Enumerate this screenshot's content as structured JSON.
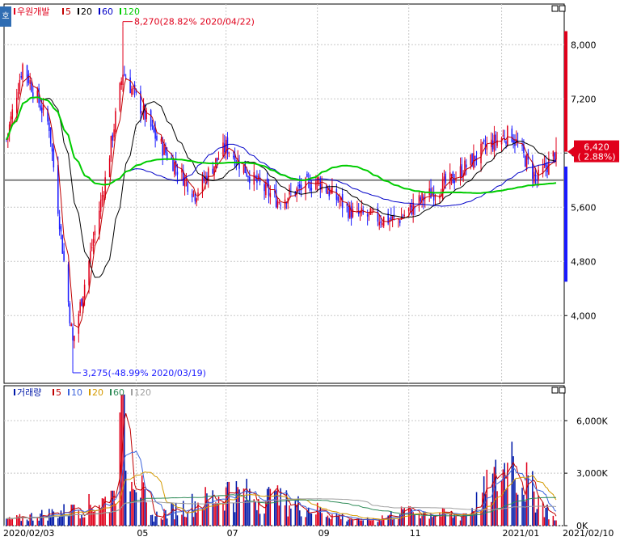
{
  "corner_label": "호",
  "colors": {
    "up": "#e0001b",
    "down": "#1a1aff",
    "ma5": "#c00000",
    "ma20": "#000000",
    "ma60": "#0000c8",
    "ma120": "#00cc00",
    "vol_ma5": "#c00000",
    "vol_ma10": "#3c64dc",
    "vol_ma20": "#d49a00",
    "vol_ma60": "#2e8b57",
    "vol_ma120": "#a0a0a0",
    "volume_bar": "#0018a8",
    "volume_bar_up": "#e0001b",
    "reference_line": "#808080",
    "grid": "#c8c8c8"
  },
  "chart_data": [
    {
      "type": "candlestick",
      "legend": [
        {
          "label": "우원개발",
          "color_key": "up"
        },
        {
          "label": "5",
          "color_key": "ma5"
        },
        {
          "label": "20",
          "color_key": "ma20"
        },
        {
          "label": "60",
          "color_key": "ma60"
        },
        {
          "label": "120",
          "color_key": "ma120"
        }
      ],
      "ylim": [
        3000,
        8600
      ],
      "yticks": [
        8000,
        7200,
        6400,
        5600,
        4800,
        4000
      ],
      "ytick_labels": [
        "8,000",
        "7,200",
        "6,400",
        "5,600",
        "4,800",
        "4,000"
      ],
      "current_price": "6,420",
      "current_change": "( 2.88%)",
      "current_value": 6420,
      "reference_value": 6000,
      "high_annotation": {
        "text": "8,270(28.82% 2020/04/22)",
        "value": 8270,
        "date": "2020/04/22"
      },
      "low_annotation": {
        "text": "3,275(-48.99% 2020/03/19)",
        "value": 3275,
        "date": "2020/03/19"
      },
      "key_points": [
        {
          "date": "2020/02/03",
          "close": 6600
        },
        {
          "date": "2020/02/14",
          "close": 7700
        },
        {
          "date": "2020/03/03",
          "close": 6800
        },
        {
          "date": "2020/03/19",
          "close": 3600
        },
        {
          "date": "2020/04/10",
          "close": 6000
        },
        {
          "date": "2020/04/22",
          "close": 7600
        },
        {
          "date": "2020/05/15",
          "close": 6600
        },
        {
          "date": "2020/06/10",
          "close": 5800
        },
        {
          "date": "2020/07/01",
          "close": 6500
        },
        {
          "date": "2020/07/20",
          "close": 6000
        },
        {
          "date": "2020/08/05",
          "close": 5700
        },
        {
          "date": "2020/09/01",
          "close": 6000
        },
        {
          "date": "2020/09/25",
          "close": 5500
        },
        {
          "date": "2020/10/25",
          "close": 5400
        },
        {
          "date": "2020/11/10",
          "close": 5700
        },
        {
          "date": "2020/12/01",
          "close": 6000
        },
        {
          "date": "2020/12/25",
          "close": 6500
        },
        {
          "date": "2021/01/10",
          "close": 6700
        },
        {
          "date": "2021/01/28",
          "close": 6000
        },
        {
          "date": "2021/02/10",
          "close": 6420
        }
      ]
    },
    {
      "type": "bar",
      "legend": [
        {
          "label": "거래량",
          "color_key": "volume_bar"
        },
        {
          "label": "5",
          "color_key": "vol_ma5"
        },
        {
          "label": "10",
          "color_key": "vol_ma10"
        },
        {
          "label": "20",
          "color_key": "vol_ma20"
        },
        {
          "label": "60",
          "color_key": "vol_ma60"
        },
        {
          "label": "120",
          "color_key": "vol_ma120"
        }
      ],
      "ylim": [
        0,
        8000
      ],
      "yticks": [
        6000,
        3000,
        0
      ],
      "ytick_labels": [
        "6,000K",
        "3,000K",
        "0K"
      ],
      "key_points": [
        {
          "date": "2020/02/03",
          "volume_k": 400
        },
        {
          "date": "2020/03/19",
          "volume_k": 1200
        },
        {
          "date": "2020/04/15",
          "volume_k": 2000
        },
        {
          "date": "2020/04/22",
          "volume_k": 7500
        },
        {
          "date": "2020/05/10",
          "volume_k": 600
        },
        {
          "date": "2020/07/03",
          "volume_k": 2500
        },
        {
          "date": "2020/08/03",
          "volume_k": 2000
        },
        {
          "date": "2020/10/01",
          "volume_k": 300
        },
        {
          "date": "2020/11/02",
          "volume_k": 1100
        },
        {
          "date": "2020/12/10",
          "volume_k": 700
        },
        {
          "date": "2021/01/10",
          "volume_k": 4800
        },
        {
          "date": "2021/02/10",
          "volume_k": 300
        }
      ]
    }
  ],
  "x_axis": {
    "start_date": "2020/02/03",
    "end_date": "2021/02/10",
    "labels": [
      {
        "text": "2020/02/03",
        "date": "2020/02/03"
      },
      {
        "text": "05",
        "date": "2020/05/01"
      },
      {
        "text": "07",
        "date": "2020/07/01"
      },
      {
        "text": "09",
        "date": "2020/09/01"
      },
      {
        "text": "11",
        "date": "2020/11/02"
      },
      {
        "text": "2021/01",
        "date": "2021/01/04"
      },
      {
        "text": "2021/02/10",
        "date": "2021/02/10"
      }
    ]
  }
}
